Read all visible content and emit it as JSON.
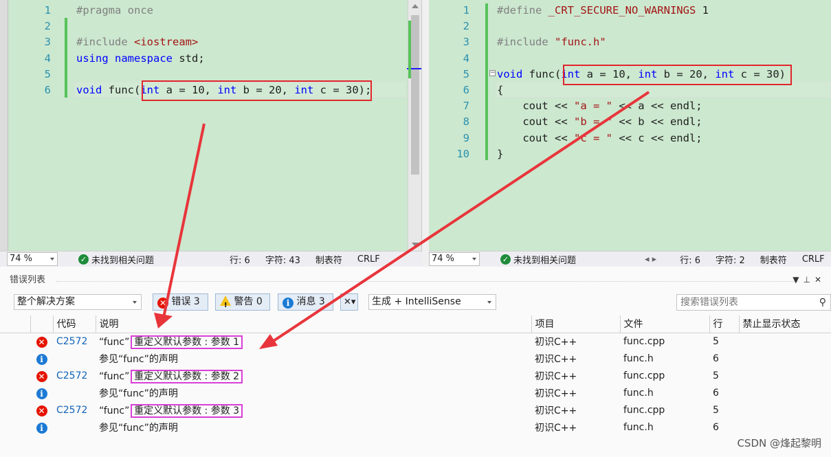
{
  "left_editor": {
    "lines": [
      {
        "n": "1",
        "tokens": [
          {
            "t": "#pragma once",
            "c": "pp"
          }
        ]
      },
      {
        "n": "2",
        "tokens": []
      },
      {
        "n": "3",
        "tokens": [
          {
            "t": "#include ",
            "c": "pp"
          },
          {
            "t": "<iostream>",
            "c": "str"
          }
        ]
      },
      {
        "n": "4",
        "tokens": [
          {
            "t": "using",
            "c": "kw"
          },
          {
            "t": " ",
            "c": "plain"
          },
          {
            "t": "namespace",
            "c": "kw"
          },
          {
            "t": " std;",
            "c": "plain"
          }
        ]
      },
      {
        "n": "5",
        "tokens": []
      },
      {
        "n": "6",
        "tokens": [
          {
            "t": "void",
            "c": "kw"
          },
          {
            "t": " func(",
            "c": "plain"
          },
          {
            "t": "int",
            "c": "kw"
          },
          {
            "t": " a = 10, ",
            "c": "plain"
          },
          {
            "t": "int",
            "c": "kw"
          },
          {
            "t": " b = 20, ",
            "c": "plain"
          },
          {
            "t": "int",
            "c": "kw"
          },
          {
            "t": " c = 30);",
            "c": "plain"
          }
        ]
      }
    ]
  },
  "right_editor": {
    "lines": [
      {
        "n": "1",
        "tokens": [
          {
            "t": "#define",
            "c": "pp"
          },
          {
            "t": " _CRT_SECURE_NO_WARNINGS",
            "c": "str"
          },
          {
            "t": " 1",
            "c": "plain"
          }
        ]
      },
      {
        "n": "2",
        "tokens": []
      },
      {
        "n": "3",
        "tokens": [
          {
            "t": "#include ",
            "c": "pp"
          },
          {
            "t": "\"func.h\"",
            "c": "str"
          }
        ]
      },
      {
        "n": "4",
        "tokens": []
      },
      {
        "n": "5",
        "tokens": [
          {
            "t": "void",
            "c": "kw"
          },
          {
            "t": " func(",
            "c": "plain"
          },
          {
            "t": "int",
            "c": "kw"
          },
          {
            "t": " a = 10, ",
            "c": "plain"
          },
          {
            "t": "int",
            "c": "kw"
          },
          {
            "t": " b = 20, ",
            "c": "plain"
          },
          {
            "t": "int",
            "c": "kw"
          },
          {
            "t": " c = 30)",
            "c": "plain"
          }
        ]
      },
      {
        "n": "6",
        "tokens": [
          {
            "t": "{",
            "c": "plain"
          }
        ]
      },
      {
        "n": "7",
        "tokens": [
          {
            "t": "    cout << ",
            "c": "plain"
          },
          {
            "t": "\"a = \"",
            "c": "str"
          },
          {
            "t": " << a << endl;",
            "c": "plain"
          }
        ]
      },
      {
        "n": "8",
        "tokens": [
          {
            "t": "    cout << ",
            "c": "plain"
          },
          {
            "t": "\"b = \"",
            "c": "str"
          },
          {
            "t": " << b << endl;",
            "c": "plain"
          }
        ]
      },
      {
        "n": "9",
        "tokens": [
          {
            "t": "    cout << ",
            "c": "plain"
          },
          {
            "t": "\"c = \"",
            "c": "str"
          },
          {
            "t": " << c << endl;",
            "c": "plain"
          }
        ]
      },
      {
        "n": "10",
        "tokens": [
          {
            "t": "}",
            "c": "plain"
          }
        ]
      }
    ]
  },
  "left_status": {
    "zoom": "74 %",
    "issues": "未找到相关问题",
    "line": "行: 6",
    "char": "字符: 43",
    "tab": "制表符",
    "eol": "CRLF"
  },
  "right_status": {
    "zoom": "74 %",
    "issues": "未找到相关问题",
    "line": "行: 6",
    "char": "字符: 2",
    "tab": "制表符",
    "eol": "CRLF"
  },
  "error_list": {
    "title": "错误列表",
    "scope": "整个解决方案",
    "errors_btn": "错误 3",
    "warnings_btn": "警告 0",
    "messages_btn": "消息 3",
    "build_filter": "生成 + IntelliSense",
    "search_placeholder": "搜索错误列表",
    "columns": {
      "code": "代码",
      "desc": "说明",
      "project": "项目",
      "file": "文件",
      "line": "行",
      "suppress": "禁止显示状态"
    },
    "rows": [
      {
        "sev": "error",
        "code": "C2572",
        "desc_prefix": "“func”:",
        "desc_main": "重定义默认参数 : 参数 1",
        "project": "初识C++",
        "file": "func.cpp",
        "line": "5"
      },
      {
        "sev": "info",
        "code": "",
        "desc_prefix": "",
        "desc_main": "参见“func”的声明",
        "project": "初识C++",
        "file": "func.h",
        "line": "6"
      },
      {
        "sev": "error",
        "code": "C2572",
        "desc_prefix": "“func”:",
        "desc_main": "重定义默认参数 : 参数 2",
        "project": "初识C++",
        "file": "func.cpp",
        "line": "5"
      },
      {
        "sev": "info",
        "code": "",
        "desc_prefix": "",
        "desc_main": "参见“func”的声明",
        "project": "初识C++",
        "file": "func.h",
        "line": "6"
      },
      {
        "sev": "error",
        "code": "C2572",
        "desc_prefix": "“func”:",
        "desc_main": "重定义默认参数 : 参数 3",
        "project": "初识C++",
        "file": "func.cpp",
        "line": "5"
      },
      {
        "sev": "info",
        "code": "",
        "desc_prefix": "",
        "desc_main": "参见“func”的声明",
        "project": "初识C++",
        "file": "func.h",
        "line": "6"
      }
    ]
  },
  "watermark": "CSDN @烽起黎明",
  "colors": {
    "annotation_red": "#e0262c",
    "annotation_magenta": "#d93fd6",
    "editor_bg": "#cce8cf"
  }
}
